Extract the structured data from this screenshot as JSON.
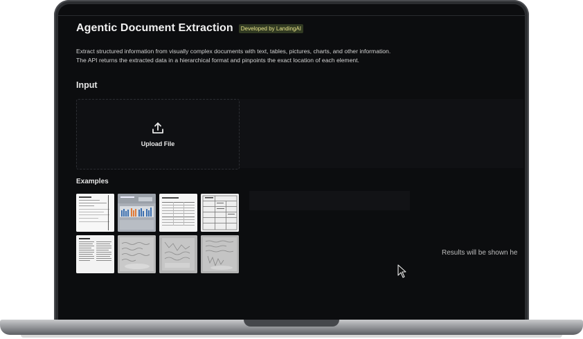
{
  "header": {
    "title": "Agentic Document Extraction",
    "badge": "Developed by LandingAI"
  },
  "description": {
    "line1": "Extract structured information from visually complex documents with text, tables, pictures, charts, and other information.",
    "line2": "The API returns the extracted data in a hierarchical format and pinpoints the exact location of each element."
  },
  "input": {
    "heading": "Input",
    "upload_label": "Upload File",
    "upload_icon": "upload-icon"
  },
  "examples": {
    "heading": "Examples",
    "items": [
      {
        "kind": "form-doc"
      },
      {
        "kind": "bar-chart-doc"
      },
      {
        "kind": "table-doc"
      },
      {
        "kind": "dense-form-doc"
      },
      {
        "kind": "text-page-doc"
      },
      {
        "kind": "handwritten-doc"
      },
      {
        "kind": "handwritten-doc-2"
      },
      {
        "kind": "handwritten-doc-3"
      }
    ]
  },
  "results": {
    "placeholder": "Results will be shown he"
  },
  "colors": {
    "background": "#0c0d0f",
    "badge_bg": "#313a22",
    "badge_text": "#e8e38a",
    "chart_blue": "#3b6fb0",
    "chart_orange": "#e07b39"
  }
}
